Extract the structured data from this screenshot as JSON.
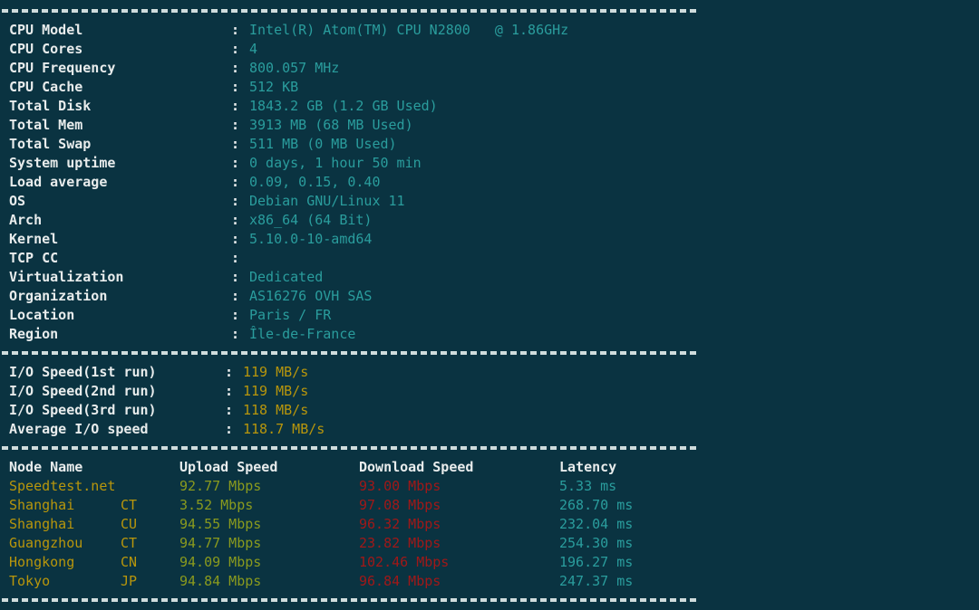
{
  "theme": {
    "background": "#0a3341",
    "label_color": "#e8ecec",
    "value_color": "#2a9d9d",
    "io_color": "#b8960c",
    "node_color": "#b8960c",
    "upload_color": "#8a9a1e",
    "download_color": "#a01818",
    "latency_color": "#2a9d9d",
    "separator_color": "#cfdcdc"
  },
  "system_info": {
    "separator": "----------------------------------------------------------------------",
    "rows": [
      {
        "label": "CPU Model",
        "colon": ":",
        "value": "Intel(R) Atom(TM) CPU N2800   @ 1.86GHz"
      },
      {
        "label": "CPU Cores",
        "colon": ":",
        "value": "4"
      },
      {
        "label": "CPU Frequency",
        "colon": ":",
        "value": "800.057 MHz"
      },
      {
        "label": "CPU Cache",
        "colon": ":",
        "value": "512 KB"
      },
      {
        "label": "Total Disk",
        "colon": ":",
        "value": "1843.2 GB (1.2 GB Used)"
      },
      {
        "label": "Total Mem",
        "colon": ":",
        "value": "3913 MB (68 MB Used)"
      },
      {
        "label": "Total Swap",
        "colon": ":",
        "value": "511 MB (0 MB Used)"
      },
      {
        "label": "System uptime",
        "colon": ":",
        "value": "0 days, 1 hour 50 min"
      },
      {
        "label": "Load average",
        "colon": ":",
        "value": "0.09, 0.15, 0.40"
      },
      {
        "label": "OS",
        "colon": ":",
        "value": "Debian GNU/Linux 11"
      },
      {
        "label": "Arch",
        "colon": ":",
        "value": "x86_64 (64 Bit)"
      },
      {
        "label": "Kernel",
        "colon": ":",
        "value": "5.10.0-10-amd64"
      },
      {
        "label": "TCP CC",
        "colon": ":",
        "value": ""
      },
      {
        "label": "Virtualization",
        "colon": ":",
        "value": "Dedicated"
      },
      {
        "label": "Organization",
        "colon": ":",
        "value": "AS16276 OVH SAS"
      },
      {
        "label": "Location",
        "colon": ":",
        "value": "Paris / FR"
      },
      {
        "label": "Region",
        "colon": ":",
        "value": "Île-de-France"
      }
    ]
  },
  "io_speed": {
    "rows": [
      {
        "label": "I/O Speed(1st run)",
        "colon": ":",
        "value": "119 MB/s"
      },
      {
        "label": "I/O Speed(2nd run)",
        "colon": ":",
        "value": "119 MB/s"
      },
      {
        "label": "I/O Speed(3rd run)",
        "colon": ":",
        "value": "118 MB/s"
      },
      {
        "label": "Average I/O speed",
        "colon": ":",
        "value": "118.7 MB/s"
      }
    ]
  },
  "network_test": {
    "headers": {
      "node": "Node Name",
      "upload": "Upload Speed",
      "download": "Download Speed",
      "latency": "Latency"
    },
    "rows": [
      {
        "node": "Speedtest.net",
        "isp": "",
        "upload": "92.77 Mbps",
        "download": "93.00 Mbps",
        "latency": "5.33 ms"
      },
      {
        "node": "Shanghai",
        "isp": "CT",
        "upload": "3.52 Mbps",
        "download": "97.08 Mbps",
        "latency": "268.70 ms"
      },
      {
        "node": "Shanghai",
        "isp": "CU",
        "upload": "94.55 Mbps",
        "download": "96.32 Mbps",
        "latency": "232.04 ms"
      },
      {
        "node": "Guangzhou",
        "isp": "CT",
        "upload": "94.77 Mbps",
        "download": "23.82 Mbps",
        "latency": "254.30 ms"
      },
      {
        "node": "Hongkong",
        "isp": "CN",
        "upload": "94.09 Mbps",
        "download": "102.46 Mbps",
        "latency": "196.27 ms"
      },
      {
        "node": "Tokyo",
        "isp": "JP",
        "upload": "94.84 Mbps",
        "download": "96.84 Mbps",
        "latency": "247.37 ms"
      }
    ]
  }
}
